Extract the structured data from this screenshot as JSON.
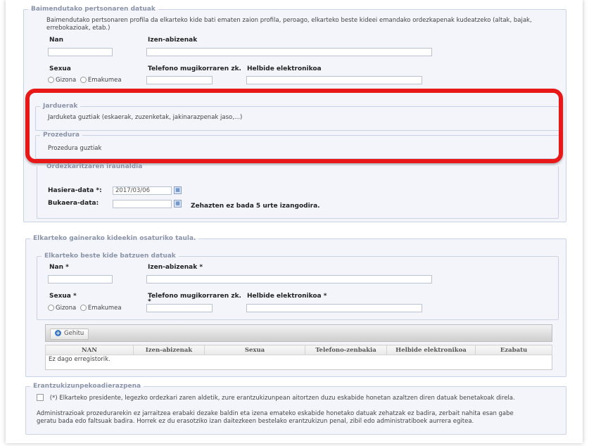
{
  "baimendutako": {
    "legend": "Baimendutako pertsonaren datuak",
    "description": "Baimendutako pertsonaren profila da elkarteko kide bati ematen zaion profila, peroago, elkarteko beste kideei emandako ordezkapenak kudeatzeko (altak, bajak, errebokazioak, etab.)",
    "nan_label": "Nan",
    "izen_label": "Izen-abizenak",
    "sexua_label": "Sexua",
    "telefono_label": "Telefono mugikorraren zk.",
    "helbide_label": "Helbide elektronikoa",
    "gizona": "Gizona",
    "emakumea": "Emakumea"
  },
  "jarduerak": {
    "legend": "Jarduerak",
    "text": "Jarduketa guztiak (eskaerak, zuzenketak, jakinarazpenak jaso,...)"
  },
  "prozedura": {
    "legend": "Prozedura",
    "text": "Prozedura guztiak"
  },
  "ordezkaritza": {
    "legend": "Ordezkaritzaren iraunaldia",
    "hasiera_label": "Hasiera-data *:",
    "hasiera_value": "2017/03/06",
    "bukaera_label": "Bukaera-data:",
    "bukaera_note": "Zehazten ez bada 5 urte izangodira."
  },
  "taula": {
    "legend": "Elkarteko gainerako kideekin osaturiko taula.",
    "inner_legend": "Elkarteko beste kide batzuen datuak",
    "nan_label": "Nan *",
    "izen_label": "Izen-abizenak *",
    "sexua_label": "Sexua *",
    "telefono_label": "Telefono mugikorraren zk.",
    "telefono_star": "*",
    "helbide_label": "Helbide elektronikoa *",
    "gizona": "Gizona",
    "emakumea": "Emakumea",
    "gehitu_label": "Gehitu",
    "gehitu_icon": "+",
    "columns": [
      "NAN",
      "Izen-abizenak",
      "Sexua",
      "Telefono-zenbakia",
      "Helbide elektronikoa",
      "Ezabatu"
    ],
    "empty": "Ez dago erregistorik."
  },
  "erantzukizun": {
    "legend": "Erantzukizunpekoadierazpena",
    "check_text": "(*) Elkarteko presidente, legezko ordezkari zaren aldetik, zure erantzukizunpean aitortzen duzu eskabide honetan azaltzen diren datuak benetakoak direla.",
    "para1": "Administrazioak prozedurarekin ez jarraitzea erabaki dezake baldin eta izena emateko eskabide honetako datuak zehatzak ez badira, zerbait nahita esan gabe",
    "para2": "geratu bada edo faltsuak badira. Horrek ez du erasotziko izan daitezkeen bestelako erantzukizun penal, zibil edo administratiboek aurrera egitea."
  },
  "icons": {
    "calendar": "calendar-icon",
    "plus": "plus-circle-icon"
  },
  "colors": {
    "highlight": "#e81818",
    "panel": "#f3f5fb",
    "border": "#c9d3e6"
  }
}
